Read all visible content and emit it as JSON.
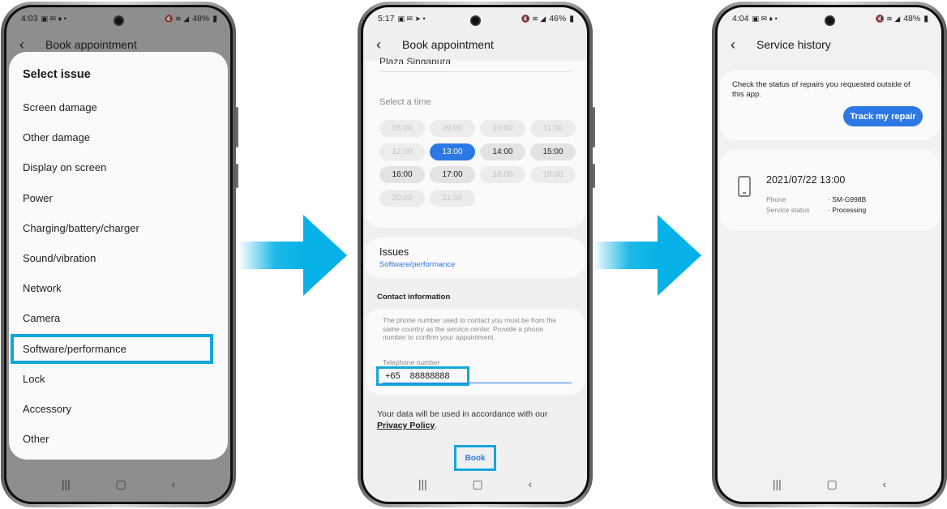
{
  "phones": [
    {
      "status": {
        "time": "4:03",
        "battery": "48%"
      },
      "title": "Book appointment",
      "sheet": {
        "title": "Select issue",
        "items": [
          "Screen damage",
          "Other damage",
          "Display on screen",
          "Power",
          "Charging/battery/charger",
          "Sound/vibration",
          "Network",
          "Camera",
          "Software/performance",
          "Lock",
          "Accessory",
          "Other"
        ],
        "selected": "Software/performance"
      }
    },
    {
      "status": {
        "time": "5:17",
        "battery": "46%"
      },
      "title": "Book appointment",
      "location_partial": "Plaza Singapura",
      "time_section": {
        "label": "Select a time",
        "slots": [
          "08:00",
          "09:00",
          "10:00",
          "11:00",
          "12:00",
          "13:00",
          "14:00",
          "15:00",
          "16:00",
          "17:00",
          "18:00",
          "19:00",
          "20:00",
          "21:00"
        ],
        "selected": "13:00"
      },
      "issues": {
        "title": "Issues",
        "value": "Software/performance"
      },
      "contact": {
        "header": "Contact information",
        "note": "The phone number used to contact you must be from the same country as the service center. Provide a phone number to confirm your appointment.",
        "phone_label": "Telephone number",
        "country_code": "+65",
        "phone_value": "88888888"
      },
      "privacy": {
        "text": "Your data will be used in accordance with our",
        "link": "Privacy Policy",
        "end": "."
      },
      "book_label": "Book"
    },
    {
      "status": {
        "time": "4:04",
        "battery": "48%"
      },
      "title": "Service history",
      "info": {
        "text": "Check the status of repairs you requested outside of this app.",
        "button": "Track my repair"
      },
      "record": {
        "datetime": "2021/07/22 13:00",
        "phone_label": "Phone",
        "phone_value": "SM-G998B",
        "status_label": "Service status",
        "status_value": "Processing"
      }
    }
  ],
  "colors": {
    "highlight": "#13a6dd",
    "accent": "#2c79e6",
    "arrow": "#05b1e6"
  },
  "icons": [
    "back-icon",
    "recent-apps-icon",
    "home-icon",
    "nav-back-icon",
    "phone-device-icon",
    "arrow-right-icon"
  ]
}
